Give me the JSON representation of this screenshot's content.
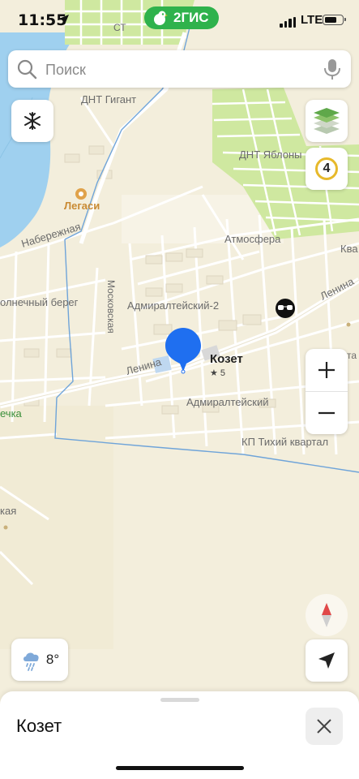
{
  "status_bar": {
    "time": "11:55",
    "network": "LTE",
    "brand": "2ГИС"
  },
  "search": {
    "placeholder": "Поиск"
  },
  "map": {
    "labels": {
      "st": "СТ",
      "dnt_gigant": "ДНТ Гигант",
      "dnt_yablony": "ДНТ Яблоны",
      "legasi": "Легаси",
      "naberezhnaya": "Набережная",
      "atmosfera": "Атмосфера",
      "kva": "Ква",
      "solnechny": "олнечный берег",
      "moskovskaya": "Московская",
      "admiralteysky2": "Адмиралтейский-2",
      "lenina_right": "Ленина",
      "lenina_main": "Ленина",
      "admiralteysky": "Адмиралтейский",
      "kp_tihiy": "КП Тихий квартал",
      "rechka": "ечка",
      "kaya": "кая",
      "ta": "та"
    },
    "place": {
      "name": "Козет",
      "rating": "★ 5"
    }
  },
  "controls": {
    "traffic_level": "4"
  },
  "weather": {
    "temperature": "8°",
    "icon": "rain-cloud-icon"
  },
  "bottom_sheet": {
    "title": "Козет"
  },
  "colors": {
    "brand": "#2fb24c",
    "pin": "#1f6ff0",
    "water": "#9fd0ef",
    "garden": "#cfe8a0",
    "boundary": "#6fa4d9"
  }
}
